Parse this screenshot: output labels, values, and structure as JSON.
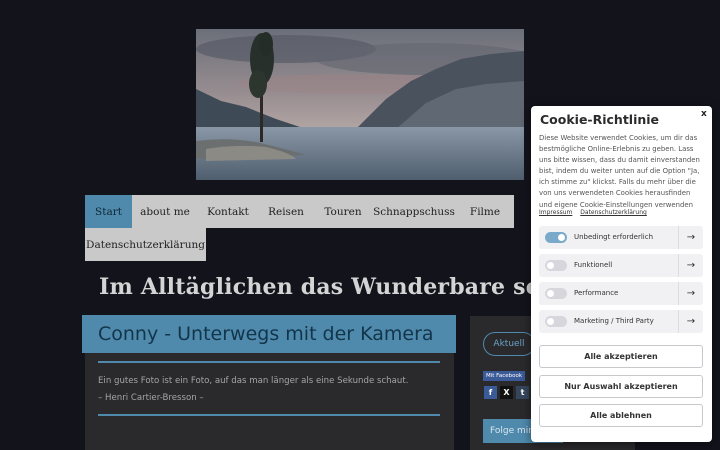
{
  "nav": {
    "items": [
      "Start",
      "about me",
      "Kontakt",
      "Reisen",
      "Touren",
      "Schnappschuss",
      "Filme"
    ],
    "items_row2": [
      "Datenschutzerklärung"
    ],
    "active": "Start"
  },
  "site_title": "Im Alltäglichen das Wunderbare sehen",
  "main": {
    "banner_title": "Conny - Unterwegs mit der Kamera",
    "quote_line1": "Ein gutes Foto ist ein Foto, auf das man länger als eine Sekunde schaut.",
    "quote_line2": "– Henri Cartier-Bresson –"
  },
  "sidebar": {
    "pill": "Aktuell",
    "fb_label": "Mit Facebook",
    "share_icons": [
      "facebook-icon",
      "x-icon",
      "tumblr-icon"
    ],
    "follow_label": "Folge mir"
  },
  "cookie": {
    "title": "Cookie-Richtlinie",
    "close": "x",
    "text_lines": [
      "Diese Website verwendet Cookies, um dir das",
      "bestmögliche Online-Erlebnis zu geben. Lass",
      "uns bitte wissen, dass du damit einverstanden",
      "bist, indem du weiter unten auf die Option \"Ja,",
      "ich stimme zu\" klickst. Falls du mehr über die",
      "von uns verwendeten Cookies herausfinden",
      "und eigene Cookie-Einstellungen verwenden"
    ],
    "link_impressum": "Impressum",
    "link_datenschutz": "Datenschutzerklärung",
    "categories": [
      {
        "label": "Unbedingt erforderlich",
        "enabled": true
      },
      {
        "label": "Funktionell",
        "enabled": false
      },
      {
        "label": "Performance",
        "enabled": false
      },
      {
        "label": "Marketing / Third Party",
        "enabled": false
      }
    ],
    "btn_accept_all": "Alle akzeptieren",
    "btn_accept_selection": "Nur Auswahl akzeptieren",
    "btn_reject_all": "Alle ablehnen"
  },
  "colors": {
    "accent": "#4f8aad",
    "background": "#13131c",
    "card": "#2a2a2d"
  }
}
